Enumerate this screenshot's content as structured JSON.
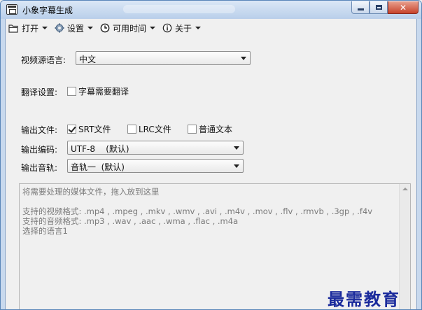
{
  "window": {
    "title": "小象字幕生成"
  },
  "menu": [
    {
      "label": "打开",
      "icon": "folder-icon"
    },
    {
      "label": "设置",
      "icon": "gear-icon"
    },
    {
      "label": "可用时间",
      "icon": "clock-icon"
    },
    {
      "label": "关于",
      "icon": "info-icon"
    }
  ],
  "source_language": {
    "label": "视频源语言:",
    "value": "中文"
  },
  "translation": {
    "label": "翻译设置:",
    "checkbox_label": "字幕需要翻译",
    "checked": false
  },
  "output_file": {
    "label": "输出文件:",
    "options": [
      {
        "label": "SRT文件",
        "checked": true
      },
      {
        "label": "LRC文件",
        "checked": false
      },
      {
        "label": "普通文本",
        "checked": false
      }
    ]
  },
  "output_encoding": {
    "label": "输出编码:",
    "value": "UTF-8    (默认)"
  },
  "output_track": {
    "label": "输出音轨:",
    "value": "音轨一  (默认)"
  },
  "drop_area": {
    "line1": "将需要处理的媒体文件，拖入放到这里",
    "line2": "支持的视频格式: .mp4 , .mpeg , .mkv , .wmv , .avi , .m4v , .mov , .flv , .rmvb , .3gp , .f4v",
    "line3": "支持的音频格式: .mp3 , .wav , .aac , .wma , .flac , .m4a",
    "line4": "选择的语言1"
  },
  "watermark": "最需教育"
}
